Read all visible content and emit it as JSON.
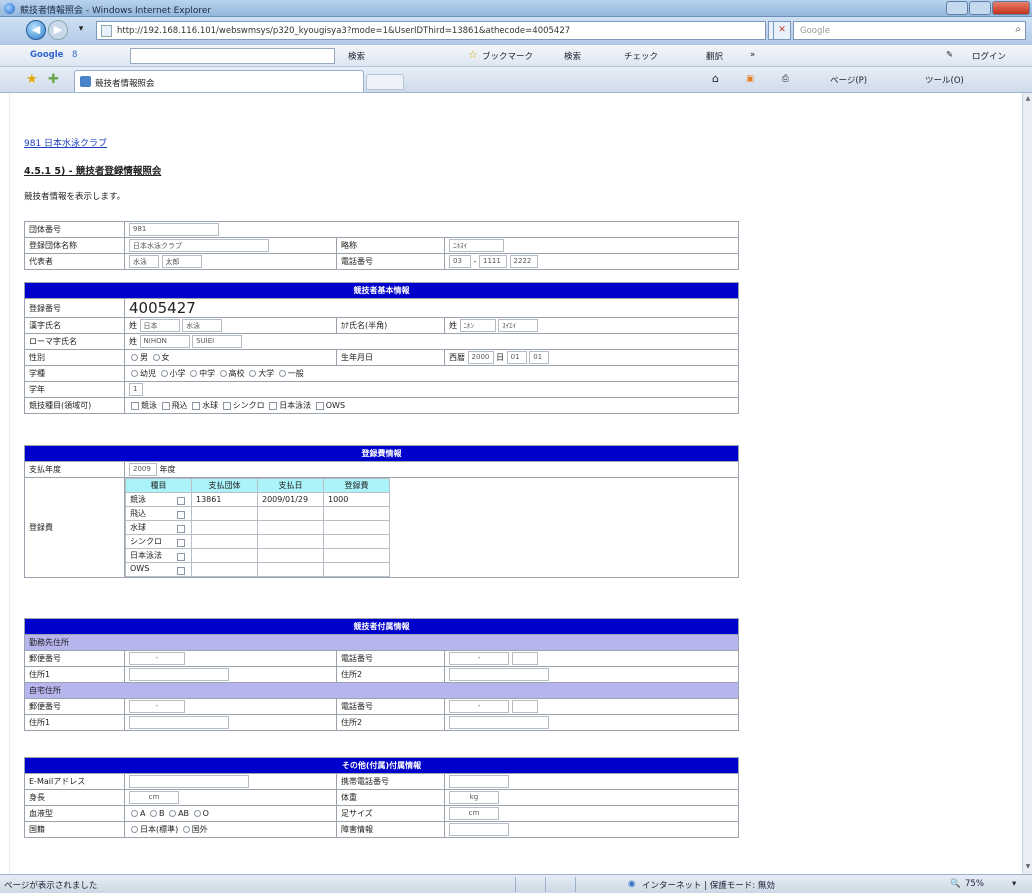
{
  "window": {
    "title": "競技者情報照会 - Windows Internet Explorer"
  },
  "address": {
    "url": "http://192.168.116.101/webswmsys/p320_kyougisya3?mode=1&UserIDThird=13861&athecode=4005427",
    "search_placeholder": "Google"
  },
  "google_toolbar": {
    "brand": "Google",
    "g_label": "8",
    "search_label": "検索",
    "bookmarks_label": "ブックマーク",
    "search2_label": "検索",
    "check_label": "チェック",
    "translate_label": "翻訳",
    "more_label": "»",
    "login_label": "ログイン"
  },
  "favorites": {
    "tab_title": "競技者情報照会",
    "page_label": "ページ(P)",
    "tools_label": "ツール(O)"
  },
  "page": {
    "club_link": "981 日本水泳クラブ",
    "heading": "4.5.1 5) - 競技者登録情報照会",
    "description": "競技者情報を表示します。"
  },
  "org": {
    "team_no_label": "団体番号",
    "team_no": "981",
    "team_name_label": "登録団体名称",
    "team_name": "日本水泳クラブ",
    "abbr_label": "略称",
    "abbr": "ﾆﾎｽｲ",
    "rep_label": "代表者",
    "rep_last": "水泳",
    "rep_first": "太郎",
    "tel_label": "電話番号",
    "tel_1": "03",
    "tel_2": "1111",
    "tel_3": "2222"
  },
  "basic": {
    "band": "競技者基本情報",
    "reg_no_label": "登録番号",
    "reg_no": "4005427",
    "kanji_label": "漢字氏名",
    "kanji_sei_tag": "姓",
    "kanji_sei": "日本",
    "kanji_mei": "水泳",
    "kana_label": "ｶﾅ氏名(半角)",
    "kana_sei_tag": "姓",
    "kana_sei": "ﾆﾎﾝ",
    "kana_mei": "ｽｲｴｲ",
    "roman_label": "ローマ字氏名",
    "roman_sei_tag": "姓",
    "roman_sei": "NIHON",
    "roman_mei": "SUIEI",
    "sex_label": "性別",
    "sex_male": "男",
    "sex_female": "女",
    "dob_label": "生年月日",
    "dob_era": "西暦",
    "dob_year": "2000",
    "dob_y_unit": "日",
    "dob_month": "01",
    "dob_day": "01",
    "school_label": "学種",
    "school_options": [
      "幼児",
      "小学",
      "中学",
      "高校",
      "大学",
      "一般"
    ],
    "grade_label": "学年",
    "grade": "1",
    "event_label": "競技種目(領域可)",
    "event_options": [
      "競泳",
      "飛込",
      "水球",
      "シンクロ",
      "日本泳法",
      "OWS"
    ]
  },
  "registration": {
    "band": "登録費情報",
    "year_label": "支払年度",
    "year": "2009",
    "year_unit": "年度",
    "fee_label": "登録費",
    "cols": [
      "種目",
      "支払団体",
      "支払日",
      "登録費"
    ],
    "rows": [
      {
        "event": "競泳",
        "org": "13861",
        "date": "2009/01/29",
        "fee": "1000"
      },
      {
        "event": "飛込",
        "org": "",
        "date": "",
        "fee": ""
      },
      {
        "event": "水球",
        "org": "",
        "date": "",
        "fee": ""
      },
      {
        "event": "シンクロ",
        "org": "",
        "date": "",
        "fee": ""
      },
      {
        "event": "日本泳法",
        "org": "",
        "date": "",
        "fee": ""
      },
      {
        "event": "OWS",
        "org": "",
        "date": "",
        "fee": ""
      }
    ]
  },
  "attached": {
    "band": "競技者付属情報",
    "work_band": "勤務先住所",
    "home_band": "自宅住所",
    "zip_label": "郵便番号",
    "tel_label": "電話番号",
    "addr1_label": "住所1",
    "addr2_label": "住所2",
    "dash": "-"
  },
  "other": {
    "band": "その他(付属)付属情報",
    "email_label": "E-Mailアドレス",
    "mobile_label": "携帯電話番号",
    "height_label": "身長",
    "height_unit": "cm",
    "weight_label": "体重",
    "weight_unit": "kg",
    "blood_label": "血液型",
    "blood_options": [
      "A",
      "B",
      "AB",
      "O"
    ],
    "foot_label": "足サイズ",
    "foot_unit": "cm",
    "nationality_label": "国籍",
    "nat_options": [
      "日本(標準)",
      "国外"
    ],
    "disability_label": "障害情報"
  },
  "status": {
    "left": "ページが表示されました",
    "zone": "インターネット | 保護モード: 無効",
    "zoom": "75%"
  }
}
